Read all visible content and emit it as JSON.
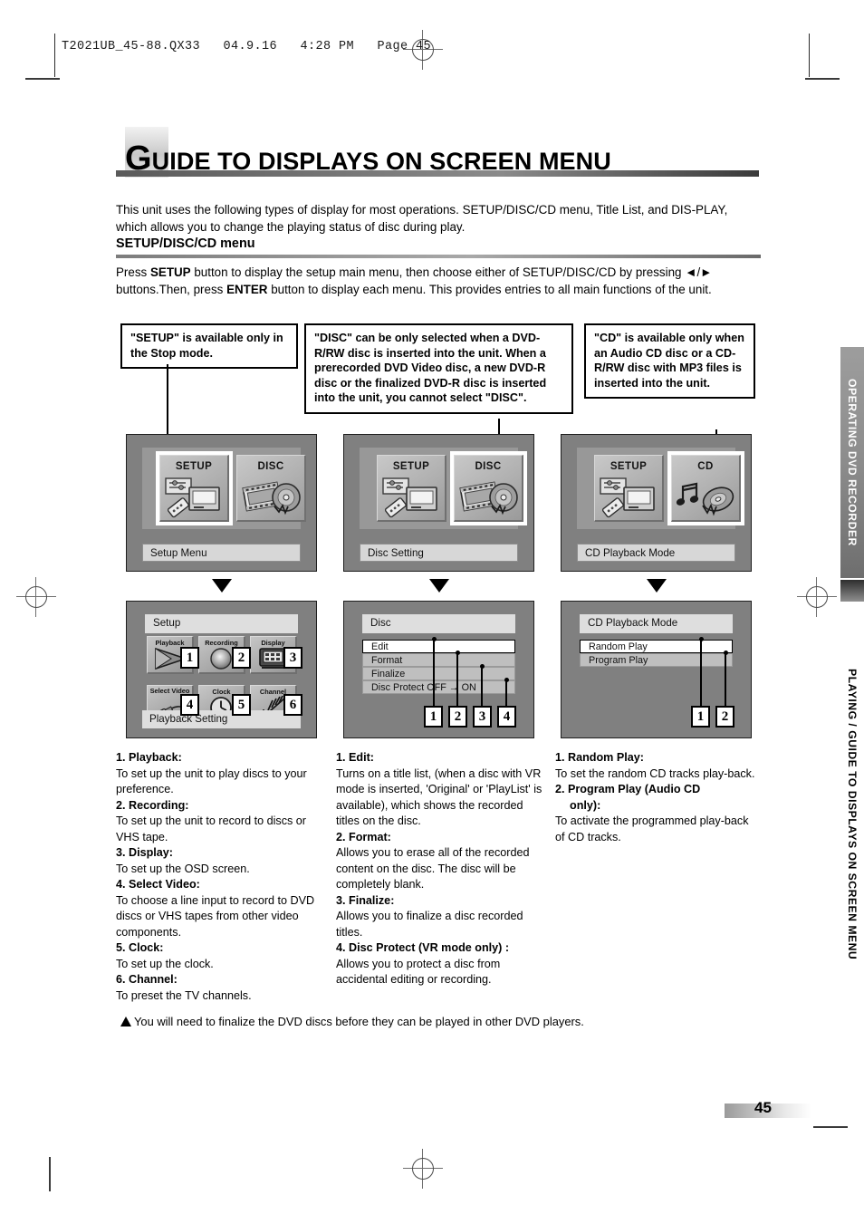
{
  "header": {
    "crop_text": "T2021UB_45-88.QX33   04.9.16   4:28 PM   Page 45"
  },
  "title": {
    "cap": "G",
    "rest": "UIDE TO DISPLAYS ON SCREEN MENU"
  },
  "intro": "This unit uses the following types of display for most operations. SETUP/DISC/CD menu, Title List, and DIS-PLAY, which allows you to change the playing status of disc during play.",
  "section": {
    "heading": "SETUP/DISC/CD menu",
    "paragraph_1": "Press ",
    "paragraph_bold_1": "SETUP",
    "paragraph_2": " button to display the setup main menu, then choose either of SETUP/DISC/CD by pressing ◄/► buttons.Then, press ",
    "paragraph_bold_2": "ENTER",
    "paragraph_3": " button to display each menu. This provides entries to all main functions of the unit."
  },
  "callouts": [
    {
      "id": "setup-callout",
      "text": "\"SETUP\" is available only in the Stop mode."
    },
    {
      "id": "disc-callout",
      "text": "\"DISC\" can be only selected when a DVD-R/RW disc is inserted into the unit. When a prerecorded DVD Video disc, a new DVD-R disc or the finalized DVD-R disc is inserted into the unit, you cannot select \"DISC\"."
    },
    {
      "id": "cd-callout",
      "text": "\"CD\" is available only when an Audio CD disc or a CD-R/RW disc with MP3 files is inserted into the unit."
    }
  ],
  "screens_top": [
    {
      "tiles": [
        {
          "label": "SETUP",
          "icon": "setup-monitor-remote-icon",
          "selected": true
        },
        {
          "label": "DISC",
          "icon": "film-strip-disc-icon",
          "selected": false
        }
      ],
      "caption": "Setup Menu"
    },
    {
      "tiles": [
        {
          "label": "SETUP",
          "icon": "setup-monitor-remote-icon",
          "selected": false
        },
        {
          "label": "DISC",
          "icon": "film-strip-disc-icon",
          "selected": true
        }
      ],
      "caption": "Disc Setting"
    },
    {
      "tiles": [
        {
          "label": "SETUP",
          "icon": "setup-monitor-remote-icon",
          "selected": false
        },
        {
          "label": "CD",
          "icon": "music-note-disc-icon",
          "selected": true
        }
      ],
      "caption": "CD Playback Mode"
    }
  ],
  "screens_bottom": {
    "setup": {
      "title": "Setup",
      "caption": "Playback Setting",
      "items": [
        {
          "num": "1",
          "label": "Playback",
          "icon": "play-triangle-icon"
        },
        {
          "num": "2",
          "label": "Recording",
          "icon": "record-circle-icon"
        },
        {
          "num": "3",
          "label": "Display",
          "icon": "osd-monitor-icon"
        },
        {
          "num": "4",
          "label": "Select Video",
          "icon": "av-cable-plug-icon"
        },
        {
          "num": "5",
          "label": "Clock",
          "icon": "clock-face-icon"
        },
        {
          "num": "6",
          "label": "Channel",
          "icon": "tv-antenna-icon"
        }
      ]
    },
    "disc": {
      "title": "Disc",
      "rows": [
        {
          "num": "1",
          "label": "Edit",
          "highlighted": true
        },
        {
          "num": "2",
          "label": "Format",
          "highlighted": false
        },
        {
          "num": "3",
          "label": "Finalize",
          "highlighted": false
        },
        {
          "num": "4",
          "label": "Disc Protect OFF → ON",
          "highlighted": false
        }
      ]
    },
    "cd": {
      "title": "CD Playback Mode",
      "rows": [
        {
          "num": "1",
          "label": "Random Play",
          "highlighted": true
        },
        {
          "num": "2",
          "label": "Program Play",
          "highlighted": false
        }
      ]
    }
  },
  "descriptions": {
    "setup": [
      {
        "term": "1. Playback:",
        "body": "To set up the unit to play discs to your preference."
      },
      {
        "term": "2. Recording:",
        "body": "To set up the unit to record to discs or VHS tape."
      },
      {
        "term": "3. Display:",
        "body": "To set up the OSD screen."
      },
      {
        "term": "4. Select Video:",
        "body": "To choose a line input to record to DVD discs or VHS tapes from other video components."
      },
      {
        "term": "5. Clock:",
        "body": "To set up the clock."
      },
      {
        "term": "6. Channel:",
        "body": "To preset the TV channels."
      }
    ],
    "disc": [
      {
        "term": "1. Edit:",
        "body": "Turns on a title list, (when a disc with VR mode is inserted, 'Original' or 'PlayList' is available), which shows the recorded titles on the disc."
      },
      {
        "term": "2. Format:",
        "body": "Allows you to erase all of the recorded content on the disc. The disc will be completely blank."
      },
      {
        "term": "3. Finalize:",
        "body": "Allows you to finalize a disc recorded titles."
      },
      {
        "term": "4. Disc Protect (VR mode only) :",
        "body": "Allows you to protect a disc from accidental editing or recording."
      }
    ],
    "cd": [
      {
        "term": "1. Random Play:",
        "body": "To set the random CD tracks play-back."
      },
      {
        "term": "2. Program Play (Audio CD",
        "term2": "only):",
        "body": "To activate the programmed play-back of CD tracks."
      }
    ]
  },
  "note": "You will need to finalize the DVD discs before they can be played in other DVD players.",
  "side_tabs": {
    "top": "OPERATING DVD RECORDER",
    "bottom": "PLAYING / GUIDE TO DISPLAYS ON SCREEN MENU"
  },
  "page_number": "45"
}
